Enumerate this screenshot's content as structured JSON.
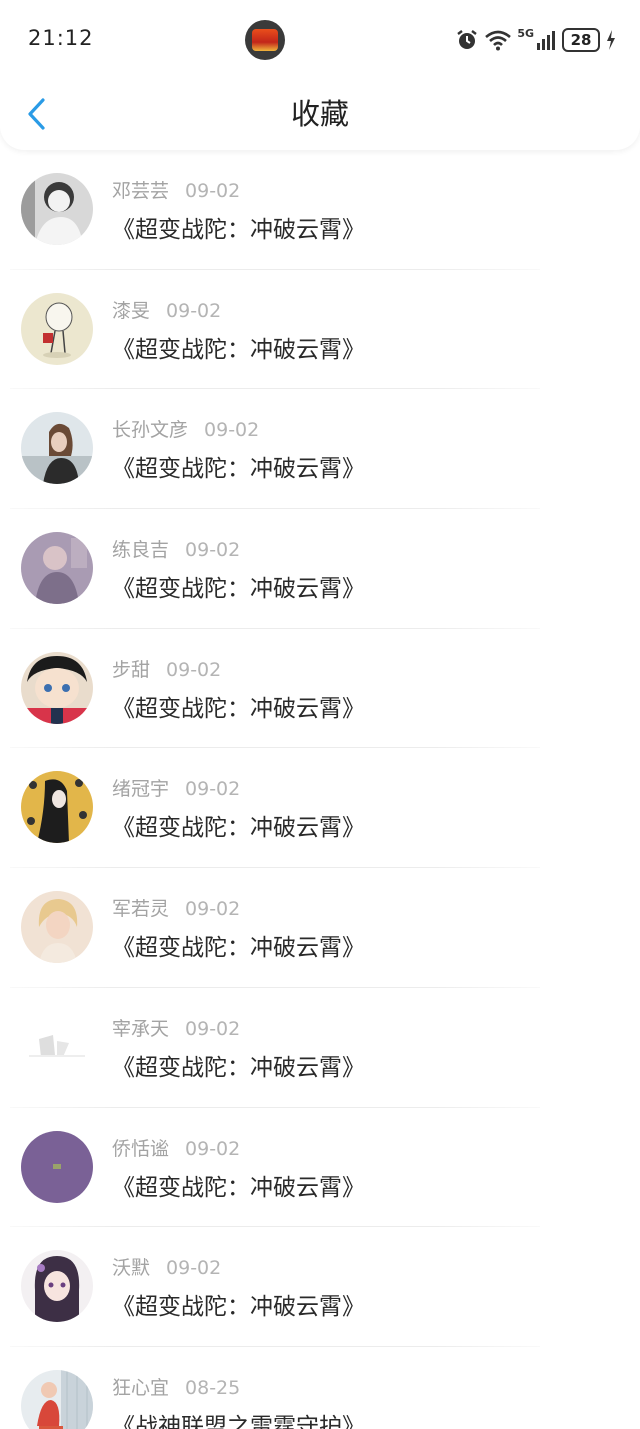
{
  "status_bar": {
    "time": "21:12",
    "battery": "28",
    "network": "5G"
  },
  "header": {
    "title": "收藏",
    "back_icon": "chevron-left-icon",
    "accent_color": "#2a9be6"
  },
  "favorites": [
    {
      "user": "邓芸芸",
      "date": "09-02",
      "title": "《超变战陀：冲破云霄》"
    },
    {
      "user": "漆旻",
      "date": "09-02",
      "title": "《超变战陀：冲破云霄》"
    },
    {
      "user": "长孙文彦",
      "date": "09-02",
      "title": "《超变战陀：冲破云霄》"
    },
    {
      "user": "练良吉",
      "date": "09-02",
      "title": "《超变战陀：冲破云霄》"
    },
    {
      "user": "步甜",
      "date": "09-02",
      "title": "《超变战陀：冲破云霄》"
    },
    {
      "user": "绪冠宇",
      "date": "09-02",
      "title": "《超变战陀：冲破云霄》"
    },
    {
      "user": "军若灵",
      "date": "09-02",
      "title": "《超变战陀：冲破云霄》"
    },
    {
      "user": "宰承天",
      "date": "09-02",
      "title": "《超变战陀：冲破云霄》"
    },
    {
      "user": "侨恬谧",
      "date": "09-02",
      "title": "《超变战陀：冲破云霄》"
    },
    {
      "user": "沃默",
      "date": "09-02",
      "title": "《超变战陀：冲破云霄》"
    },
    {
      "user": "狂心宜",
      "date": "08-25",
      "title": "《战神联盟之雷霆守护》"
    }
  ]
}
